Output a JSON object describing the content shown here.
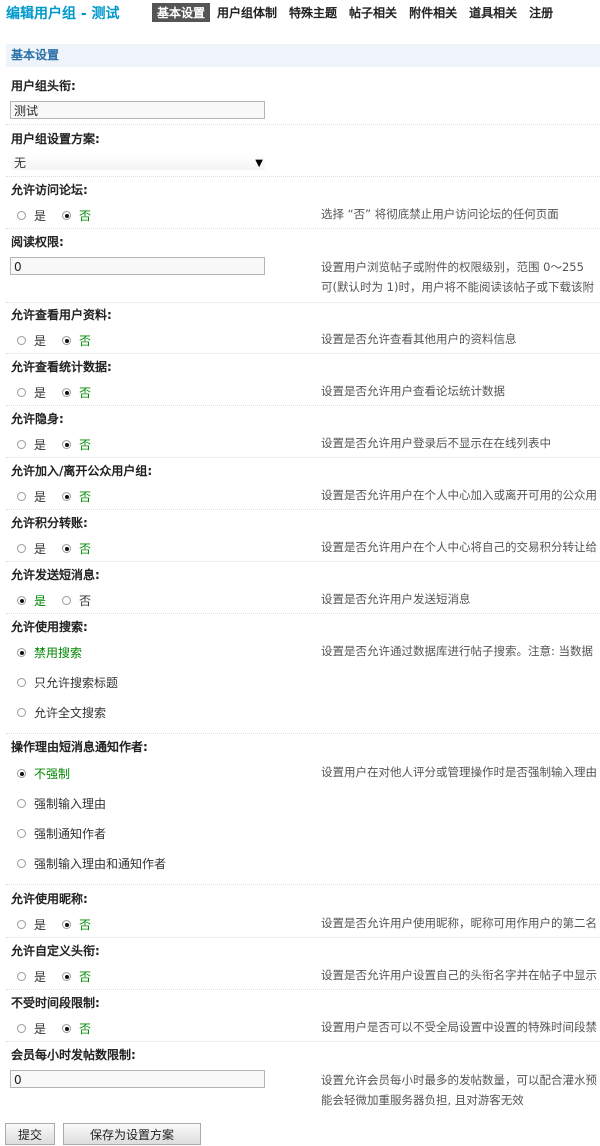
{
  "header": {
    "title": "编辑用户组 - 测试",
    "tabs": [
      "基本设置",
      "用户组体制",
      "特殊主题",
      "帖子相关",
      "附件相关",
      "道具相关",
      "注册"
    ]
  },
  "section": {
    "title": "基本设置"
  },
  "fields": {
    "title_label": "用户组头衔:",
    "title_value": "测试",
    "scheme_label": "用户组设置方案:",
    "scheme_value": "无",
    "visit_label": "允许访问论坛:",
    "visit_desc": "选择 “否” 将彻底禁止用户访问论坛的任何页面",
    "read_label": "阅读权限:",
    "read_value": "0",
    "read_desc1": "设置用户浏览帖子或附件的权限级别，范围 0～255",
    "read_desc2": "可(默认时为 1)时，用户将不能阅读该帖子或下载该附",
    "profile_label": "允许查看用户资料:",
    "profile_desc": "设置是否允许查看其他用户的资料信息",
    "stats_label": "允许查看统计数据:",
    "stats_desc": "设置是否允许用户查看论坛统计数据",
    "invisible_label": "允许隐身:",
    "invisible_desc": "设置是否允许用户登录后不显示在在线列表中",
    "join_label": "允许加入/离开公众用户组:",
    "join_desc": "设置是否允许用户在个人中心加入或离开可用的公众用",
    "transfer_label": "允许积分转账:",
    "transfer_desc": "设置是否允许用户在个人中心将自己的交易积分转让给",
    "pm_label": "允许发送短消息:",
    "pm_desc": "设置是否允许用户发送短消息",
    "search_label": "允许使用搜索:",
    "search_desc": "设置是否允许通过数据库进行帖子搜索。注意: 当数据",
    "search_opts": [
      "禁用搜索",
      "只允许搜索标题",
      "允许全文搜索"
    ],
    "reason_label": "操作理由短消息通知作者:",
    "reason_desc": "设置用户在对他人评分或管理操作时是否强制输入理由",
    "reason_opts": [
      "不强制",
      "强制输入理由",
      "强制通知作者",
      "强制输入理由和通知作者"
    ],
    "nick_label": "允许使用昵称:",
    "nick_desc": "设置是否允许用户使用昵称，昵称可用作用户的第二名",
    "customtitle_label": "允许自定义头衔:",
    "customtitle_desc": "设置是否允许用户设置自己的头衔名字并在帖子中显示",
    "period_label": "不受时间段限制:",
    "period_desc": "设置用户是否可以不受全局设置中设置的特殊时间段禁",
    "rate_label": "会员每小时发帖数限制:",
    "rate_value": "0",
    "rate_desc1": "设置允许会员每小时最多的发帖数量，可以配合灌水预",
    "rate_desc2": "能会轻微加重服务器负担, 且对游客无效"
  },
  "yes": "是",
  "no": "否",
  "buttons": {
    "submit": "提交",
    "save_scheme": "保存为设置方案"
  }
}
